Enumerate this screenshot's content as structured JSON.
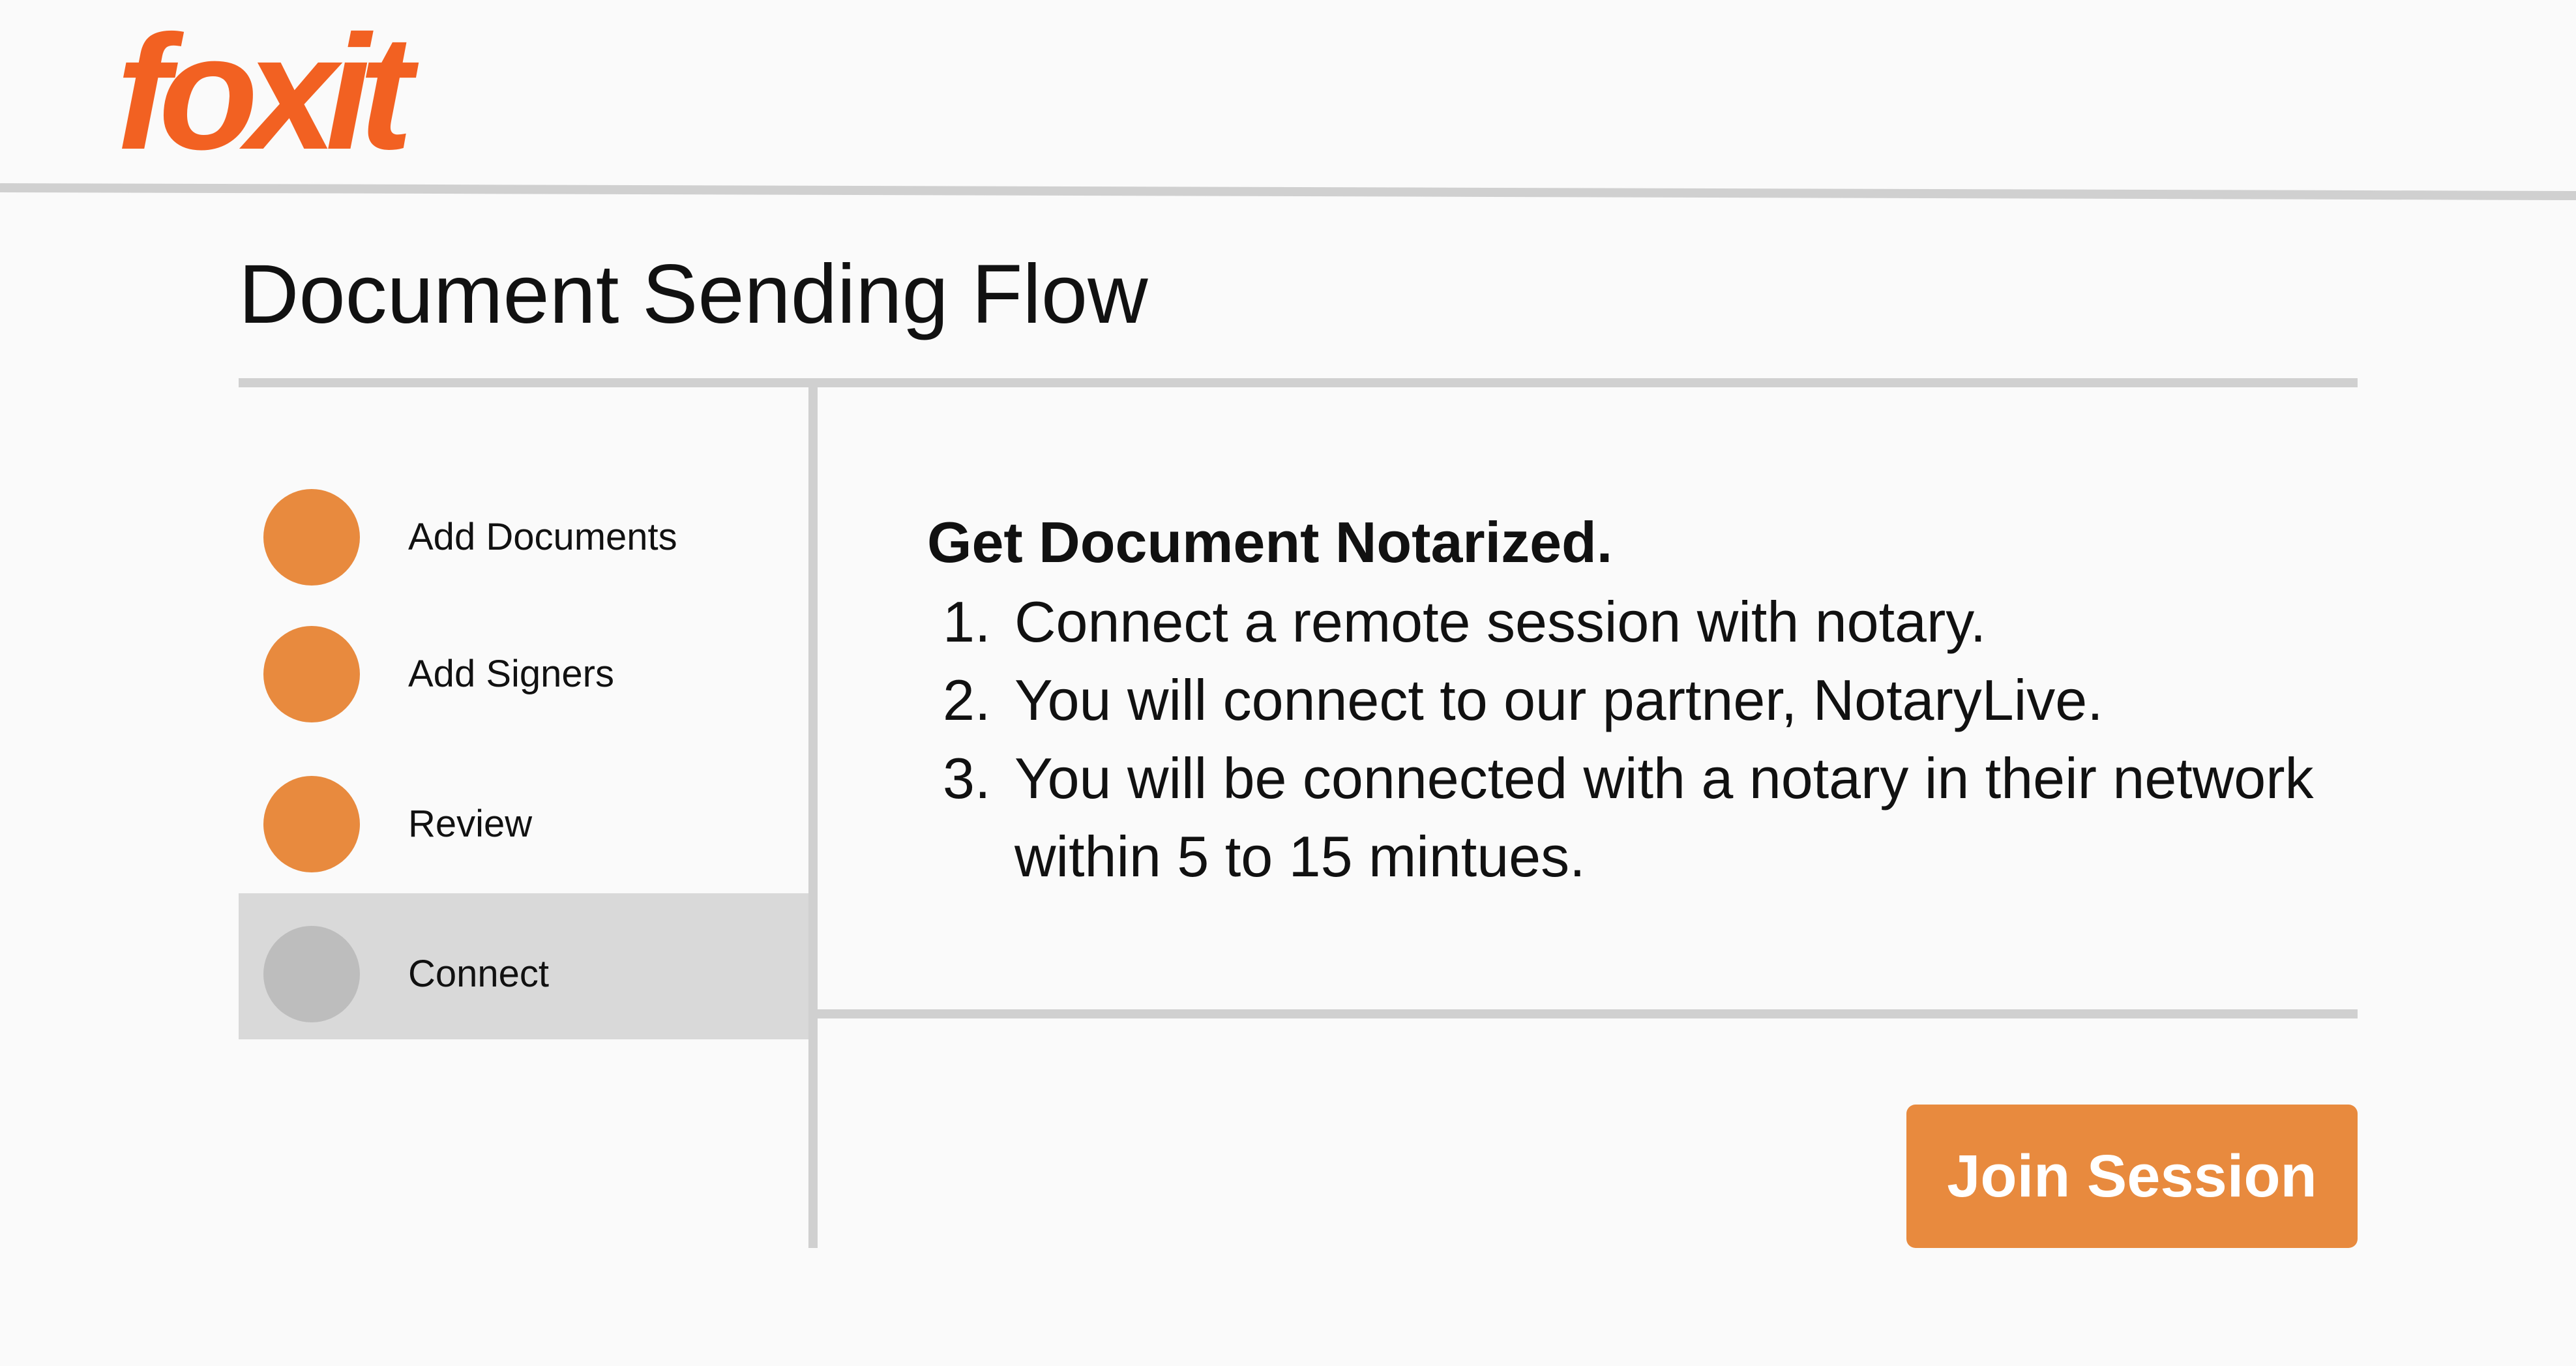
{
  "brand": {
    "logo_text": "foxit",
    "color": "#f26122"
  },
  "page": {
    "title": "Document Sending Flow"
  },
  "steps": [
    {
      "label": "Add Documents",
      "status": "complete"
    },
    {
      "label": "Add Signers",
      "status": "complete"
    },
    {
      "label": "Review",
      "status": "complete"
    },
    {
      "label": "Connect",
      "status": "current"
    }
  ],
  "colors": {
    "accent": "#e88a3e",
    "pending_dot": "#bdbdbd",
    "active_row": "#d9d9d9",
    "divider": "#d0d0d0",
    "background": "#fafafa"
  },
  "content": {
    "heading": "Get Document Notarized.",
    "items": [
      {
        "number": "1.",
        "text": "Connect a remote session with notary."
      },
      {
        "number": "2.",
        "text": "You will connect to our partner, NotaryLive."
      },
      {
        "number": "3.",
        "text": "You will be connected with a notary in their network within 5 to 15 mintues."
      }
    ]
  },
  "actions": {
    "join_label": "Join Session"
  }
}
